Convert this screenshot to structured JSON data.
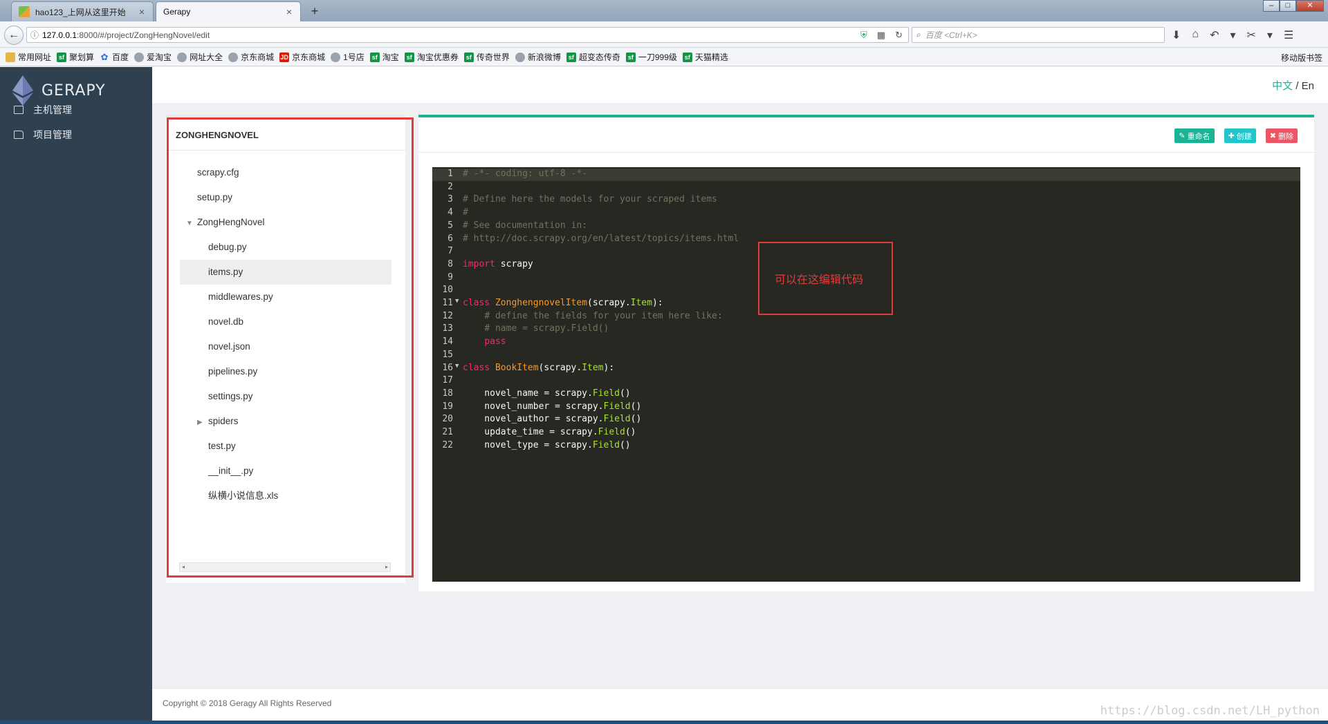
{
  "browser": {
    "tabs": [
      {
        "title": "hao123_上网从这里开始",
        "active": false
      },
      {
        "title": "Gerapy",
        "active": true
      }
    ],
    "url_host": "127.0.0.1",
    "url_path": ":8000/#/project/ZongHengNovel/edit",
    "search_placeholder": "百度 <Ctrl+K>",
    "bookmarks": [
      {
        "label": "常用网址",
        "icon": "folder-icon"
      },
      {
        "label": "聚划算",
        "icon": "sf-icon"
      },
      {
        "label": "百度",
        "icon": "baidu-icon"
      },
      {
        "label": "爱淘宝",
        "icon": "globe-icon"
      },
      {
        "label": "网址大全",
        "icon": "globe-icon"
      },
      {
        "label": "京东商城",
        "icon": "globe-icon"
      },
      {
        "label": "京东商城",
        "icon": "jd-icon"
      },
      {
        "label": "1号店",
        "icon": "globe-icon"
      },
      {
        "label": "淘宝",
        "icon": "sf-icon"
      },
      {
        "label": "淘宝优惠券",
        "icon": "sf-icon"
      },
      {
        "label": "传奇世界",
        "icon": "sf-icon"
      },
      {
        "label": "新浪微博",
        "icon": "globe-icon"
      },
      {
        "label": "超变态传奇",
        "icon": "sf-icon"
      },
      {
        "label": "一刀999级",
        "icon": "sf-icon"
      },
      {
        "label": "天猫精选",
        "icon": "sf-icon"
      }
    ],
    "mobile_bookmarks": "移动版书签"
  },
  "app": {
    "logo": "GERAPY",
    "menu": [
      "主机管理",
      "项目管理"
    ],
    "lang_zh": "中文",
    "lang_sep": " / ",
    "lang_en": "En"
  },
  "project": {
    "name": "ZONGHENGNOVEL",
    "tree": [
      {
        "label": "scrapy.cfg",
        "level": 1
      },
      {
        "label": "setup.py",
        "level": 1
      },
      {
        "label": "ZongHengNovel",
        "level": 1,
        "toggle": "expanded"
      },
      {
        "label": "debug.py",
        "level": 2
      },
      {
        "label": "items.py",
        "level": 2,
        "selected": true
      },
      {
        "label": "middlewares.py",
        "level": 2
      },
      {
        "label": "novel.db",
        "level": 2
      },
      {
        "label": "novel.json",
        "level": 2
      },
      {
        "label": "pipelines.py",
        "level": 2
      },
      {
        "label": "settings.py",
        "level": 2
      },
      {
        "label": "spiders",
        "level": 2,
        "toggle": "collapsed"
      },
      {
        "label": "test.py",
        "level": 2
      },
      {
        "label": "__init__.py",
        "level": 2
      },
      {
        "label": "纵横小说信息.xls",
        "level": 2
      }
    ]
  },
  "editor": {
    "buttons": {
      "rename": "重命名",
      "create": "创建",
      "delete": "删除"
    },
    "lines": [
      [
        [
          "c",
          "# -*- coding: utf-8 -*-"
        ]
      ],
      [],
      [
        [
          "c",
          "# Define here the models for your scraped items"
        ]
      ],
      [
        [
          "c",
          "#"
        ]
      ],
      [
        [
          "c",
          "# See documentation in:"
        ]
      ],
      [
        [
          "c",
          "# http://doc.scrapy.org/en/latest/topics/items.html"
        ]
      ],
      [],
      [
        [
          "k",
          "import"
        ],
        [
          "w",
          " scrapy"
        ]
      ],
      [],
      [],
      [
        [
          "k",
          "class"
        ],
        [
          "w",
          " "
        ],
        [
          "cls",
          "ZonghengnovelItem"
        ],
        [
          "w",
          "(scrapy."
        ],
        [
          "b",
          "Item"
        ],
        [
          "w",
          "):"
        ]
      ],
      [
        [
          "w",
          "    "
        ],
        [
          "c",
          "# define the fields for your item here like:"
        ]
      ],
      [
        [
          "w",
          "    "
        ],
        [
          "c",
          "# name = scrapy.Field()"
        ]
      ],
      [
        [
          "w",
          "    "
        ],
        [
          "k",
          "pass"
        ]
      ],
      [],
      [
        [
          "k",
          "class"
        ],
        [
          "w",
          " "
        ],
        [
          "cls",
          "BookItem"
        ],
        [
          "w",
          "(scrapy."
        ],
        [
          "b",
          "Item"
        ],
        [
          "w",
          "):"
        ]
      ],
      [],
      [
        [
          "w",
          "    novel_name = scrapy."
        ],
        [
          "b",
          "Field"
        ],
        [
          "w",
          "()"
        ]
      ],
      [
        [
          "w",
          "    novel_number = scrapy."
        ],
        [
          "b",
          "Field"
        ],
        [
          "w",
          "()"
        ]
      ],
      [
        [
          "w",
          "    novel_author = scrapy."
        ],
        [
          "b",
          "Field"
        ],
        [
          "w",
          "()"
        ]
      ],
      [
        [
          "w",
          "    update_time = scrapy."
        ],
        [
          "b",
          "Field"
        ],
        [
          "w",
          "()"
        ]
      ],
      [
        [
          "w",
          "    novel_type = scrapy."
        ],
        [
          "b",
          "Field"
        ],
        [
          "w",
          "()"
        ]
      ]
    ],
    "fold_lines": [
      11,
      16
    ],
    "active_line": 1,
    "annotation": "可以在这编辑代码"
  },
  "footer": {
    "copyright": "Copyright © 2018 Geragy All Rights Reserved",
    "watermark": "https://blog.csdn.net/LH_python"
  }
}
